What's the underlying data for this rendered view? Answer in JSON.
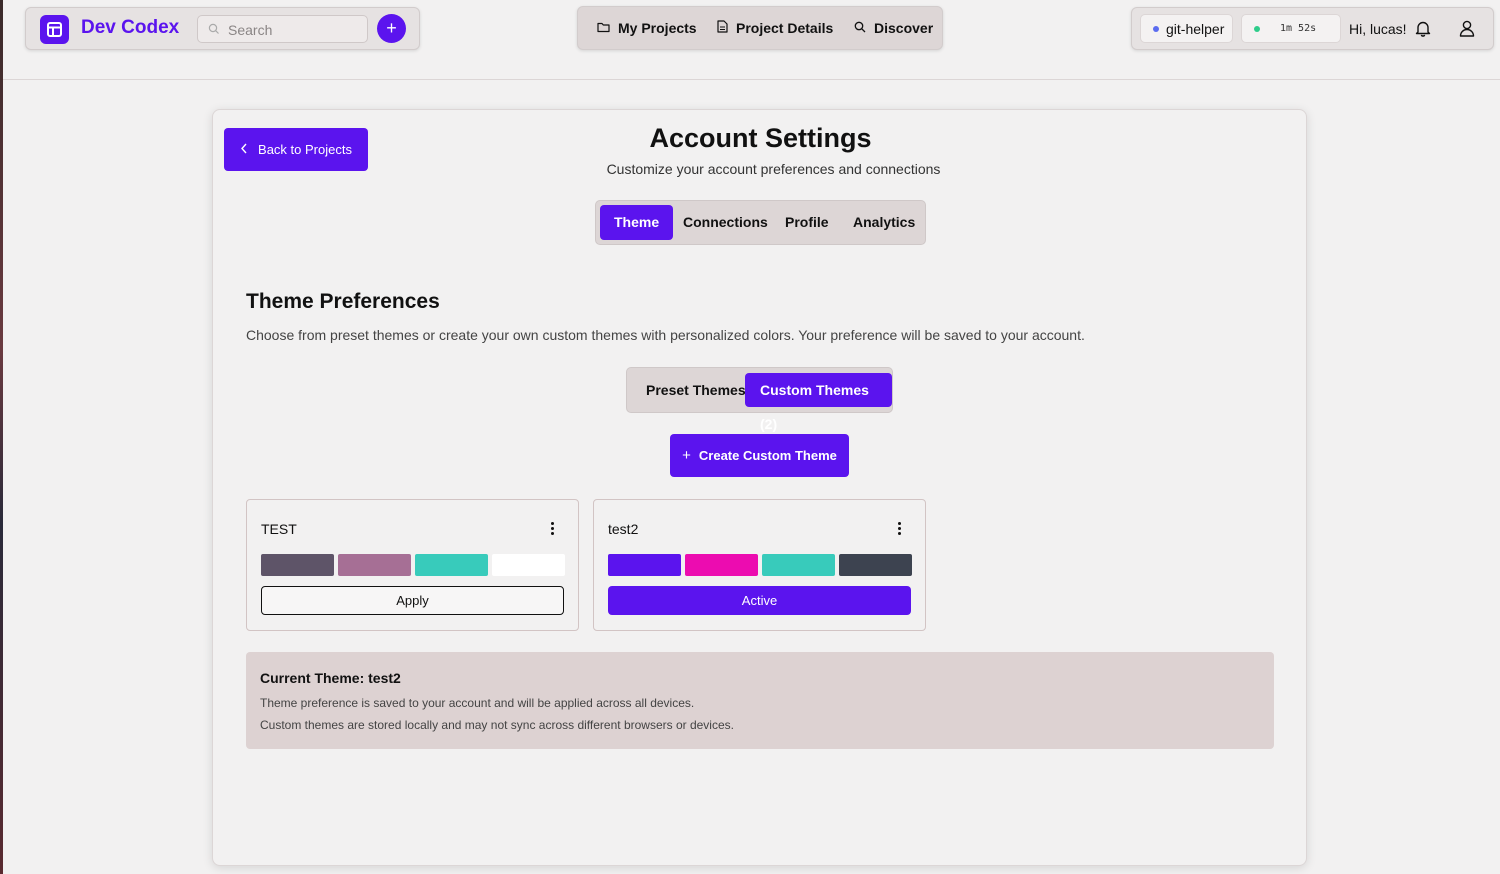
{
  "header": {
    "brand": "Dev Codex",
    "search_placeholder": "Search",
    "add_label": "+",
    "nav": [
      {
        "label": "My Projects",
        "icon": "folder-icon"
      },
      {
        "label": "Project Details",
        "icon": "document-icon"
      },
      {
        "label": "Discover",
        "icon": "search-icon"
      }
    ],
    "session_chip": "git-helper",
    "timer": "1m 52s",
    "greeting": "Hi, lucas!"
  },
  "page": {
    "back_label": "Back to Projects",
    "title": "Account Settings",
    "subtitle": "Customize your account preferences and connections",
    "tabs": [
      "Theme",
      "Connections",
      "Profile",
      "Analytics"
    ],
    "active_tab": "Theme"
  },
  "theme": {
    "section_title": "Theme Preferences",
    "section_desc": "Choose from preset themes or create your own custom themes with personalized colors. Your preference will be saved to your account.",
    "subtabs": [
      "Preset Themes",
      "Custom Themes (2)"
    ],
    "active_subtab": "Custom Themes (2)",
    "create_label": "Create Custom Theme",
    "custom_themes": [
      {
        "name": "TEST",
        "colors": [
          "#5e5468",
          "#a66f95",
          "#38cbbb",
          "#ffffff"
        ],
        "action": "Apply"
      },
      {
        "name": "test2",
        "colors": [
          "#5b14ee",
          "#ec0cb0",
          "#38cbbb",
          "#3d4350"
        ],
        "action": "Active"
      }
    ],
    "info": {
      "title": "Current Theme: test2",
      "line1": "Theme preference is saved to your account and will be applied across all devices.",
      "line2": "Custom themes are stored locally and may not sync across different browsers or devices."
    }
  },
  "colors": {
    "accent": "#5b14ee",
    "session_dot": "#5b6cf0",
    "status_dot": "#2ecc8a"
  }
}
